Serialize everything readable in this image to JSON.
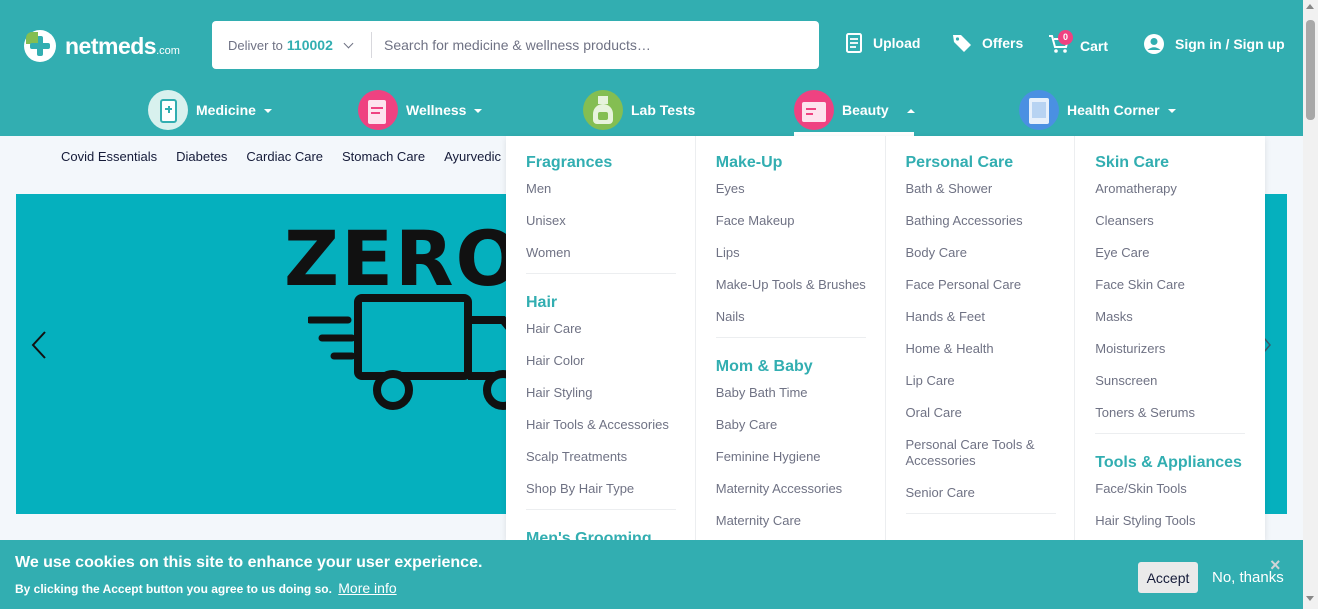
{
  "header": {
    "logo_name": "netmeds",
    "logo_suffix": ".com",
    "deliver_label": "Deliver to",
    "pincode": "110002",
    "search_placeholder": "Search for medicine & wellness products…",
    "upload": "Upload",
    "offers": "Offers",
    "cart": "Cart",
    "cart_count": "0",
    "signin": "Sign in / Sign up"
  },
  "nav": {
    "medicine": "Medicine",
    "wellness": "Wellness",
    "lab_tests": "Lab Tests",
    "beauty": "Beauty",
    "health_corner": "Health Corner"
  },
  "subnav": [
    "Covid Essentials",
    "Diabetes",
    "Cardiac Care",
    "Stomach Care",
    "Ayurvedic"
  ],
  "banner": {
    "headline": "ZERO"
  },
  "megamenu": {
    "col1": {
      "fragrances": {
        "title": "Fragrances",
        "items": [
          "Men",
          "Unisex",
          "Women"
        ]
      },
      "hair": {
        "title": "Hair",
        "items": [
          "Hair Care",
          "Hair Color",
          "Hair Styling",
          "Hair Tools & Accessories",
          "Scalp Treatments",
          "Shop By Hair Type"
        ]
      },
      "mens_grooming": {
        "title": "Men's Grooming"
      }
    },
    "col2": {
      "makeup": {
        "title": "Make-Up",
        "items": [
          "Eyes",
          "Face Makeup",
          "Lips",
          "Make-Up Tools & Brushes",
          "Nails"
        ]
      },
      "mom_baby": {
        "title": "Mom & Baby",
        "items": [
          "Baby Bath Time",
          "Baby Care",
          "Feminine Hygiene",
          "Maternity Accessories",
          "Maternity Care"
        ]
      }
    },
    "col3": {
      "personal_care": {
        "title": "Personal Care",
        "items": [
          "Bath & Shower",
          "Bathing Accessories",
          "Body Care",
          "Face Personal Care",
          "Hands & Feet",
          "Home & Health",
          "Lip Care",
          "Oral Care",
          "Personal Care Tools & Accessories",
          "Senior Care"
        ]
      }
    },
    "col4": {
      "skin_care": {
        "title": "Skin Care",
        "items": [
          "Aromatherapy",
          "Cleansers",
          "Eye Care",
          "Face Skin Care",
          "Masks",
          "Moisturizers",
          "Sunscreen",
          "Toners & Serums"
        ]
      },
      "tools": {
        "title": "Tools & Appliances",
        "items": [
          "Face/Skin Tools",
          "Hair Styling Tools"
        ]
      }
    }
  },
  "cookie": {
    "title": "We use cookies on this site to enhance your user experience.",
    "text": "By clicking the Accept button you agree to us doing so.",
    "more_info": "More info",
    "accept": "Accept",
    "no_thanks": "No, thanks",
    "close": "×"
  },
  "colors": {
    "brand": "#32aeb1",
    "banner": "#05b0be",
    "badge": "#ef4281",
    "text": "#151b39",
    "muted": "#6f7284"
  }
}
